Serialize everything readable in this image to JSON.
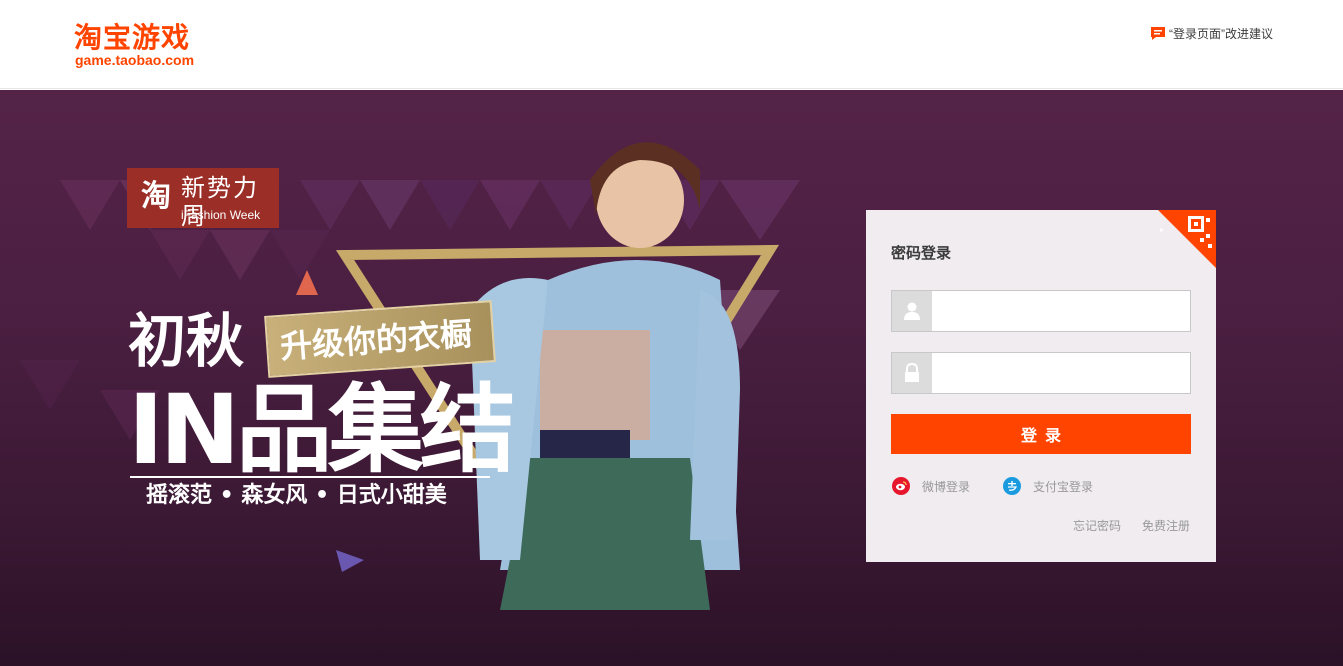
{
  "header": {
    "logo_cn": "淘宝游戏",
    "logo_en": "game.taobao.com",
    "feedback_text": "“登录页面”改进建议",
    "brand_color": "#ff4400"
  },
  "banner": {
    "badge_hanzi": "淘",
    "badge_title": "新势力周",
    "badge_en": "iFashion Week",
    "headline_1": "初秋",
    "tag": "升级你的衣橱",
    "headline_2": "IN品集结",
    "subline": "摇滚范 • 森女风 • 日式小甜美",
    "background_color": "#4a1f41"
  },
  "login": {
    "title": "密码登录",
    "username_placeholder": "",
    "password_placeholder": "",
    "submit_label": "登录",
    "weibo_label": "微博登录",
    "alipay_label": "支付宝登录",
    "forgot_label": "忘记密码",
    "register_label": "免费注册",
    "icons": {
      "user": "user-icon",
      "lock": "lock-icon",
      "qr": "qr-code-icon",
      "weibo": "weibo-icon",
      "alipay": "alipay-icon"
    }
  }
}
